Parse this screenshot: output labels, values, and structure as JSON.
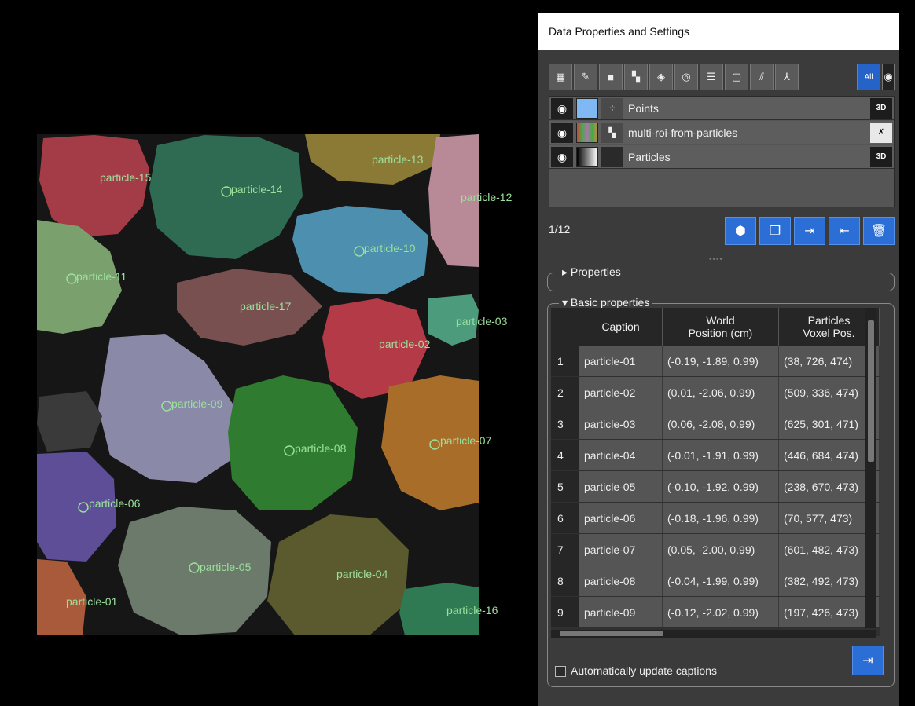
{
  "viewport": {
    "labels": [
      "particle-01",
      "particle-02",
      "particle-03",
      "particle-04",
      "particle-05",
      "particle-06",
      "particle-07",
      "particle-08",
      "particle-09",
      "particle-10",
      "particle-11",
      "particle-12",
      "particle-13",
      "particle-14",
      "particle-15",
      "particle-16",
      "particle-17"
    ]
  },
  "panel": {
    "title": "Data Properties and Settings",
    "toolbar": {
      "icons": [
        "grid-icon",
        "pencil-icon",
        "square-icon",
        "blocks-icon",
        "diamond-icon",
        "sphere-icon",
        "layers-icon",
        "frame-icon",
        "lines-icon",
        "axis-icon"
      ],
      "all_label": "All",
      "eye_icon": "eye-icon"
    },
    "layers": [
      {
        "name": "Points",
        "tag": "3D",
        "color": "#7fb8f2"
      },
      {
        "name": "multi-roi-from-particles",
        "tag": "✗",
        "color": "#8a6b3c"
      },
      {
        "name": "Particles",
        "tag": "3D",
        "color": "#aaaaaa"
      }
    ],
    "counter": "1/12",
    "properties_title": "Properties",
    "basic_title": "Basic properties",
    "table": {
      "headers": [
        "Caption",
        "World\nPosition (cm)",
        "Particles\nVoxel Pos."
      ],
      "rows": [
        {
          "n": "1",
          "caption": "particle-01",
          "world": "(-0.19, -1.89, 0.99)",
          "voxel": "(38, 726, 474)"
        },
        {
          "n": "2",
          "caption": "particle-02",
          "world": "(0.01, -2.06, 0.99)",
          "voxel": "(509, 336, 474)"
        },
        {
          "n": "3",
          "caption": "particle-03",
          "world": "(0.06, -2.08, 0.99)",
          "voxel": "(625, 301, 471)"
        },
        {
          "n": "4",
          "caption": "particle-04",
          "world": "(-0.01, -1.91, 0.99)",
          "voxel": "(446, 684, 474)"
        },
        {
          "n": "5",
          "caption": "particle-05",
          "world": "(-0.10, -1.92, 0.99)",
          "voxel": "(238, 670, 473)"
        },
        {
          "n": "6",
          "caption": "particle-06",
          "world": "(-0.18, -1.96, 0.99)",
          "voxel": "(70, 577, 473)"
        },
        {
          "n": "7",
          "caption": "particle-07",
          "world": "(0.05, -2.00, 0.99)",
          "voxel": "(601, 482, 473)"
        },
        {
          "n": "8",
          "caption": "particle-08",
          "world": "(-0.04, -1.99, 0.99)",
          "voxel": "(382, 492, 473)"
        },
        {
          "n": "9",
          "caption": "particle-09",
          "world": "(-0.12, -2.02, 0.99)",
          "voxel": "(197, 426, 473)"
        }
      ]
    },
    "auto_update_label": "Automatically update captions"
  }
}
